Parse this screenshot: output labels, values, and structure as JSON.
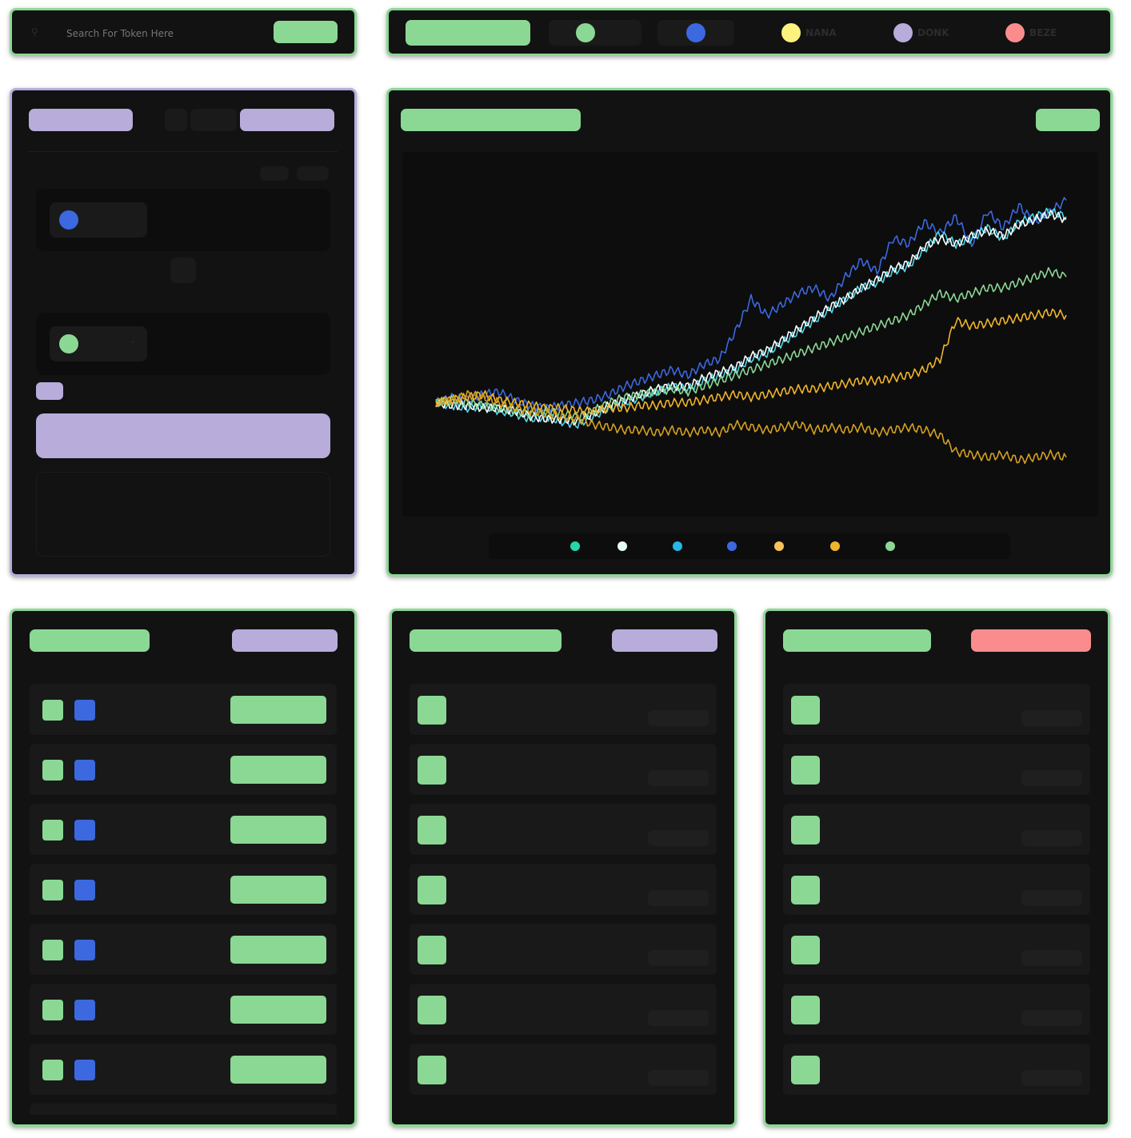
{
  "search": {
    "placeholder": "Search For Token Here",
    "button_label": ""
  },
  "ticker": {
    "items": [
      {
        "label": "",
        "color": "#8bd895"
      },
      {
        "label": "",
        "color": "#3c68e0"
      },
      {
        "label": "NANA",
        "color": "#fdf27d"
      },
      {
        "label": "DONK",
        "color": "#b8acdb"
      },
      {
        "label": "BEZE",
        "color": "#fb8c8d"
      }
    ]
  },
  "swap": {
    "title": "",
    "tab_active": "",
    "from_token_icon_color": "#3c68e0",
    "to_token_icon_color": "#8bd895",
    "submit_label": ""
  },
  "chart_panel": {
    "title": "",
    "range_label": ""
  },
  "chart_data": {
    "type": "line",
    "x": [
      0,
      1,
      2,
      3,
      4,
      5,
      6,
      7,
      8,
      9,
      10,
      11,
      12,
      13,
      14,
      15,
      16,
      17,
      18,
      19,
      20,
      21,
      22,
      23,
      24,
      25,
      26,
      27,
      28,
      29,
      30,
      31,
      32,
      33,
      34,
      35,
      36,
      37,
      38,
      39,
      40
    ],
    "series": [
      {
        "color": "#3c68e0",
        "values": [
          0,
          2,
          1,
          3,
          4,
          1,
          -1,
          -2,
          -1,
          0,
          1,
          3,
          6,
          8,
          10,
          12,
          10,
          14,
          16,
          26,
          38,
          32,
          36,
          40,
          42,
          38,
          46,
          52,
          48,
          60,
          58,
          66,
          62,
          68,
          58,
          70,
          64,
          72,
          66,
          70,
          74
        ]
      },
      {
        "color": "#4dd6e8",
        "values": [
          0,
          -1,
          -2,
          -1,
          -3,
          -4,
          -6,
          -5,
          -7,
          -8,
          -5,
          -2,
          0,
          2,
          4,
          6,
          5,
          8,
          10,
          12,
          16,
          18,
          22,
          26,
          30,
          34,
          38,
          42,
          44,
          48,
          50,
          56,
          62,
          58,
          60,
          64,
          60,
          66,
          68,
          70,
          68
        ]
      },
      {
        "color": "#ffffff",
        "values": [
          0,
          -1,
          -1,
          -2,
          -2,
          -3,
          -5,
          -6,
          -6,
          -7,
          -4,
          -1,
          1,
          3,
          5,
          6,
          6,
          9,
          11,
          13,
          17,
          19,
          23,
          27,
          31,
          35,
          38,
          42,
          45,
          49,
          51,
          57,
          60,
          58,
          61,
          63,
          61,
          65,
          67,
          69,
          67
        ]
      },
      {
        "color": "#8bd895",
        "values": [
          0,
          1,
          0,
          -1,
          -2,
          -3,
          -4,
          -3,
          -4,
          -5,
          -3,
          0,
          2,
          3,
          4,
          5,
          4,
          6,
          8,
          10,
          12,
          14,
          16,
          18,
          20,
          22,
          24,
          26,
          28,
          30,
          32,
          36,
          40,
          38,
          40,
          42,
          42,
          44,
          46,
          48,
          46
        ]
      },
      {
        "color": "#f0b429",
        "values": [
          0,
          1,
          2,
          3,
          1,
          0,
          -1,
          -2,
          -2,
          -3,
          -3,
          -2,
          -2,
          -1,
          -1,
          0,
          0,
          1,
          2,
          3,
          2,
          3,
          4,
          5,
          5,
          6,
          7,
          8,
          8,
          9,
          10,
          12,
          16,
          30,
          28,
          29,
          30,
          31,
          32,
          33,
          32
        ]
      },
      {
        "color": "#d4a020",
        "values": [
          0,
          1,
          3,
          2,
          0,
          -2,
          -3,
          -4,
          -5,
          -6,
          -8,
          -9,
          -10,
          -10,
          -11,
          -10,
          -11,
          -10,
          -11,
          -8,
          -9,
          -10,
          -9,
          -8,
          -10,
          -9,
          -10,
          -9,
          -11,
          -10,
          -9,
          -10,
          -12,
          -18,
          -19,
          -20,
          -19,
          -21,
          -20,
          -19,
          -20
        ]
      }
    ],
    "ylim": [
      -30,
      80
    ],
    "legend_colors": [
      "#26d6a8",
      "#e6fbf6",
      "#28b6e8",
      "#3c68e0",
      "#f8c25a",
      "#f0b429",
      "#8bd895"
    ]
  },
  "holders": {
    "title": "",
    "rows": [
      {
        "value": ""
      },
      {
        "value": ""
      },
      {
        "value": ""
      },
      {
        "value": ""
      },
      {
        "value": ""
      },
      {
        "value": ""
      },
      {
        "value": ""
      }
    ]
  },
  "trades": {
    "title": "",
    "rows": [
      {},
      {},
      {},
      {},
      {},
      {},
      {}
    ]
  },
  "alerts": {
    "title": "",
    "rows": [
      {},
      {},
      {},
      {},
      {},
      {},
      {}
    ]
  }
}
